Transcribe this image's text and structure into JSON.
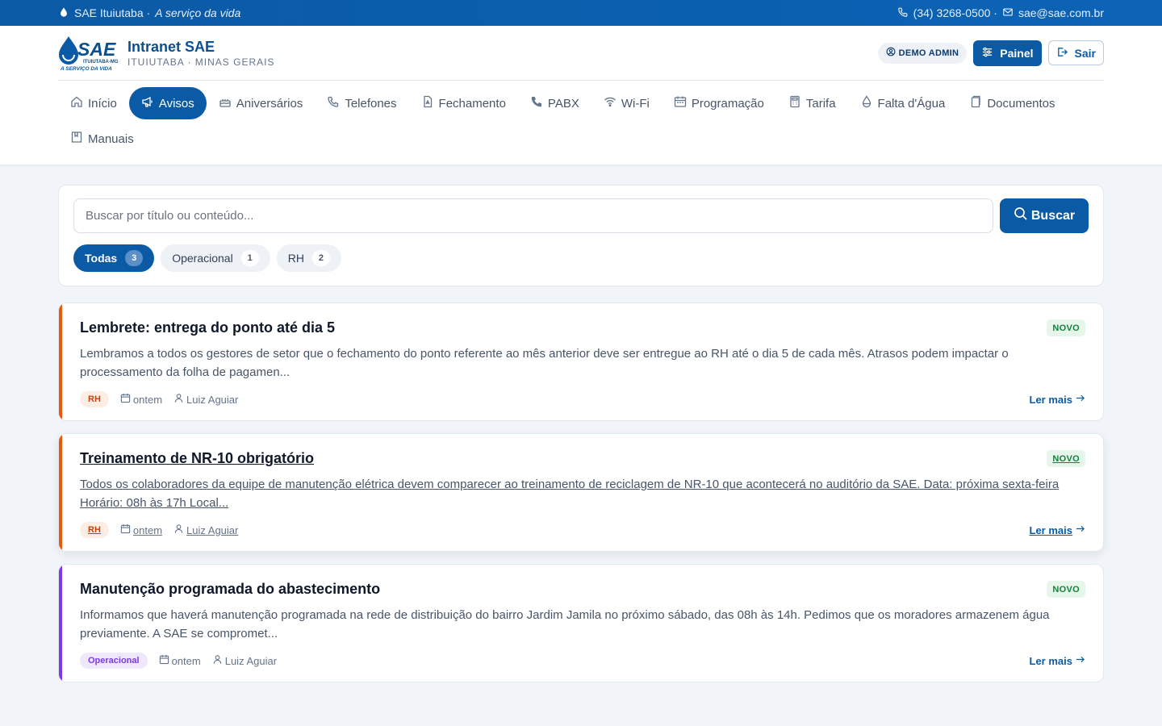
{
  "topbar": {
    "org": "SAE Ituiutaba ·",
    "tagline": "A serviço da vida",
    "phone": "(34) 3268-0500 ·",
    "email": "sae@sae.com.br"
  },
  "brand": {
    "logo_text": "SAE",
    "logo_sub1": "ITUIUTABA-MG",
    "logo_sub2": "A SERVIÇO DA VIDA",
    "title": "Intranet SAE",
    "subtitle": "ITUIUTABA · MINAS GERAIS"
  },
  "user": {
    "role": "DEMO ADMIN",
    "panel_label": "Painel",
    "logout_label": "Sair"
  },
  "nav": {
    "items": [
      {
        "label": "Início",
        "icon": "home-icon"
      },
      {
        "label": "Avisos",
        "icon": "megaphone-icon"
      },
      {
        "label": "Aniversários",
        "icon": "cake-icon"
      },
      {
        "label": "Telefones",
        "icon": "phone-icon"
      },
      {
        "label": "Fechamento",
        "icon": "document-icon"
      },
      {
        "label": "PABX",
        "icon": "phone-solid-icon"
      },
      {
        "label": "Wi-Fi",
        "icon": "wifi-icon"
      },
      {
        "label": "Programação",
        "icon": "calendar-icon"
      },
      {
        "label": "Tarifa",
        "icon": "calculator-icon"
      },
      {
        "label": "Falta d'Água",
        "icon": "droplet-icon"
      },
      {
        "label": "Documentos",
        "icon": "files-icon"
      },
      {
        "label": "Manuais",
        "icon": "book-icon"
      }
    ],
    "active": "Avisos"
  },
  "search": {
    "placeholder": "Buscar por título ou conteúdo...",
    "value": "",
    "button_label": "Buscar"
  },
  "filters": [
    {
      "label": "Todas",
      "count": "3",
      "active": true
    },
    {
      "label": "Operacional",
      "count": "1",
      "active": false
    },
    {
      "label": "RH",
      "count": "2",
      "active": false
    }
  ],
  "notices": [
    {
      "title": "Lembrete: entrega do ponto até dia 5",
      "badge": "NOVO",
      "body": "Lembramos a todos os gestores de setor que o fechamento do ponto referente ao mês anterior deve ser entregue ao RH até o dia 5 de cada mês. Atrasos podem impactar o processamento da folha de pagamen...",
      "category": "RH",
      "date": "ontem",
      "author": "Luiz Aguiar",
      "read_more": "Ler mais",
      "accent": "#ea580c"
    },
    {
      "title": "Treinamento de NR-10 obrigatório",
      "badge": "NOVO",
      "body": "Todos os colaboradores da equipe de manutenção elétrica devem comparecer ao treinamento de reciclagem de NR-10 que acontecerá no auditório da SAE. Data: próxima sexta-feira Horário: 08h às 17h Local...",
      "category": "RH",
      "date": "ontem",
      "author": "Luiz Aguiar",
      "read_more": "Ler mais",
      "accent": "#ea580c"
    },
    {
      "title": "Manutenção programada do abastecimento",
      "badge": "NOVO",
      "body": "Informamos que haverá manutenção programada na rede de distribuição do bairro Jardim Jamila no próximo sábado, das 08h às 14h. Pedimos que os moradores armazenem água previamente. A SAE se compromet...",
      "category": "Operacional",
      "date": "ontem",
      "author": "Luiz Aguiar",
      "read_more": "Ler mais",
      "accent": "#7c3aed"
    }
  ],
  "colors": {
    "brand": "#0b5aa5",
    "rh": "#ea580c",
    "operacional": "#7c3aed",
    "new_badge": "#15803d"
  }
}
